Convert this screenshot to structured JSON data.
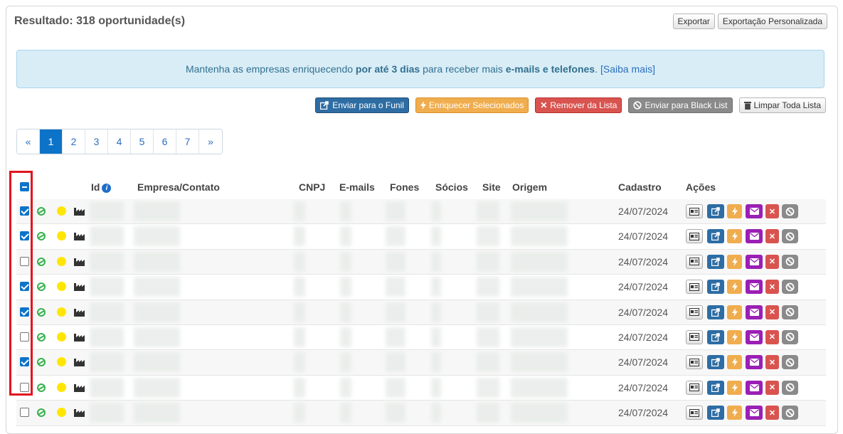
{
  "header": {
    "title": "Resultado: 318 oportunidade(s)",
    "export_label": "Exportar",
    "custom_export_label": "Exportação Personalizada"
  },
  "alert": {
    "text_before": "Mantenha as empresas enriquecendo",
    "bold1": "por até 3 dias",
    "text_middle": "para receber mais",
    "bold2": "e-mails e telefones",
    "text_after": ".",
    "link": "[Saiba mais]"
  },
  "bulk_actions": {
    "funnel": "Enviar para o Funil",
    "enrich": "Enriquecer Selecionados",
    "remove": "Remover da Lista",
    "blacklist": "Enviar para Black List",
    "clear": "Limpar Toda Lista"
  },
  "pagination": [
    "«",
    "1",
    "2",
    "3",
    "4",
    "5",
    "6",
    "7",
    "»"
  ],
  "pagination_active": "1",
  "table": {
    "headers": {
      "id": "Id",
      "company": "Empresa/Contato",
      "cnpj": "CNPJ",
      "emails": "E-mails",
      "phones": "Fones",
      "partners": "Sócios",
      "site": "Site",
      "origin": "Origem",
      "created": "Cadastro",
      "actions": "Ações"
    },
    "rows": [
      {
        "checked": true,
        "date": "24/07/2024"
      },
      {
        "checked": true,
        "date": "24/07/2024"
      },
      {
        "checked": false,
        "date": "24/07/2024"
      },
      {
        "checked": true,
        "date": "24/07/2024"
      },
      {
        "checked": true,
        "date": "24/07/2024"
      },
      {
        "checked": false,
        "date": "24/07/2024"
      },
      {
        "checked": true,
        "date": "24/07/2024"
      },
      {
        "checked": false,
        "date": "24/07/2024"
      },
      {
        "checked": false,
        "date": "24/07/2024"
      }
    ]
  },
  "icons": {
    "status_ok": "green-status-icon",
    "status_pending": "yellow-dot-icon",
    "type": "factory-icon",
    "row_actions": [
      "contact-card-icon",
      "share-icon",
      "bolt-icon",
      "envelope-icon",
      "close-icon",
      "ban-icon"
    ]
  },
  "colors": {
    "primary": "#0d73c9",
    "alert_bg": "#d9edf7",
    "highlight": "#e1141e"
  }
}
